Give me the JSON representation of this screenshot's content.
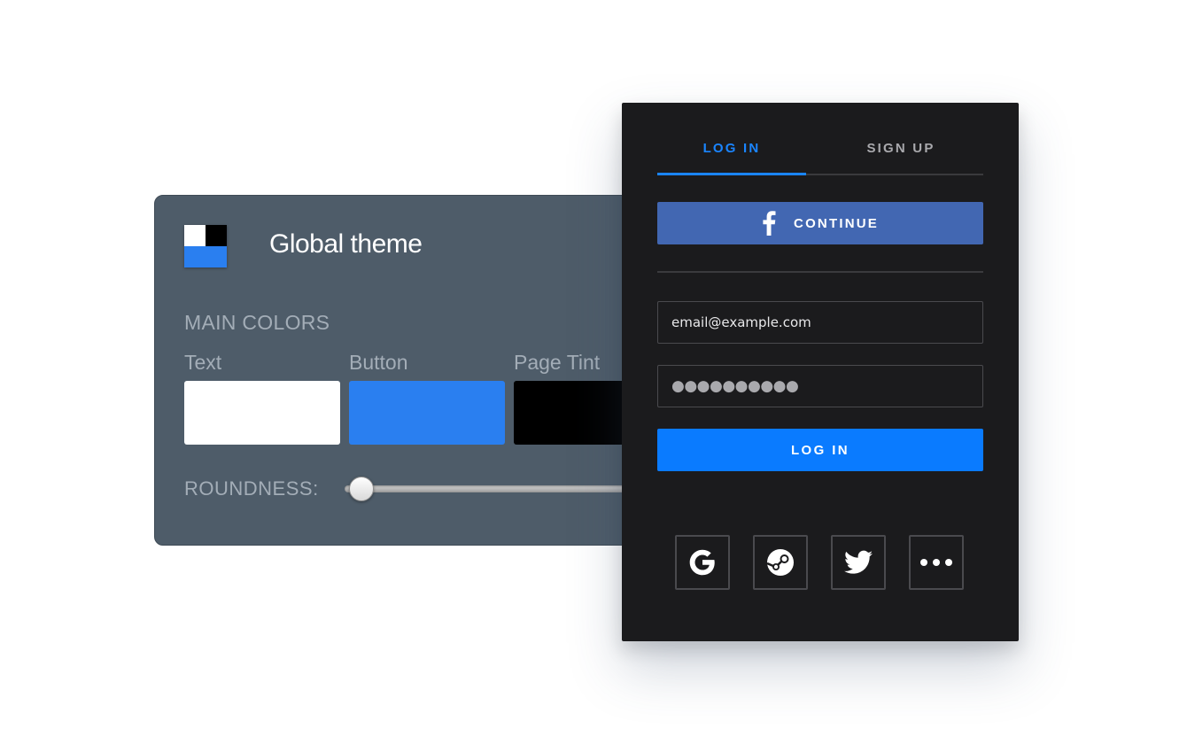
{
  "theme_panel": {
    "title": "Global theme",
    "section_label": "MAIN COLORS",
    "swatches": [
      {
        "label": "Text",
        "color": "#ffffff"
      },
      {
        "label": "Button",
        "color": "#2a7ff0"
      },
      {
        "label": "Page Tint",
        "color": "#000000"
      }
    ],
    "roundness_label": "ROUNDNESS:",
    "roundness_value": 0.05
  },
  "login_panel": {
    "tabs": [
      {
        "label": "LOG IN",
        "active": true
      },
      {
        "label": "SIGN UP",
        "active": false
      }
    ],
    "facebook_button": {
      "label": "CONTINUE",
      "icon": "facebook-icon"
    },
    "email_value": "email@example.com",
    "password_value": "●●●●●●●●●●",
    "login_button": "LOG IN",
    "social_providers": [
      {
        "name": "google",
        "icon": "google-icon"
      },
      {
        "name": "steam",
        "icon": "steam-icon"
      },
      {
        "name": "twitter",
        "icon": "twitter-icon"
      },
      {
        "name": "more",
        "icon": "more-icon"
      }
    ],
    "accent_color": "#1a85ff",
    "facebook_color": "#4267b2"
  }
}
